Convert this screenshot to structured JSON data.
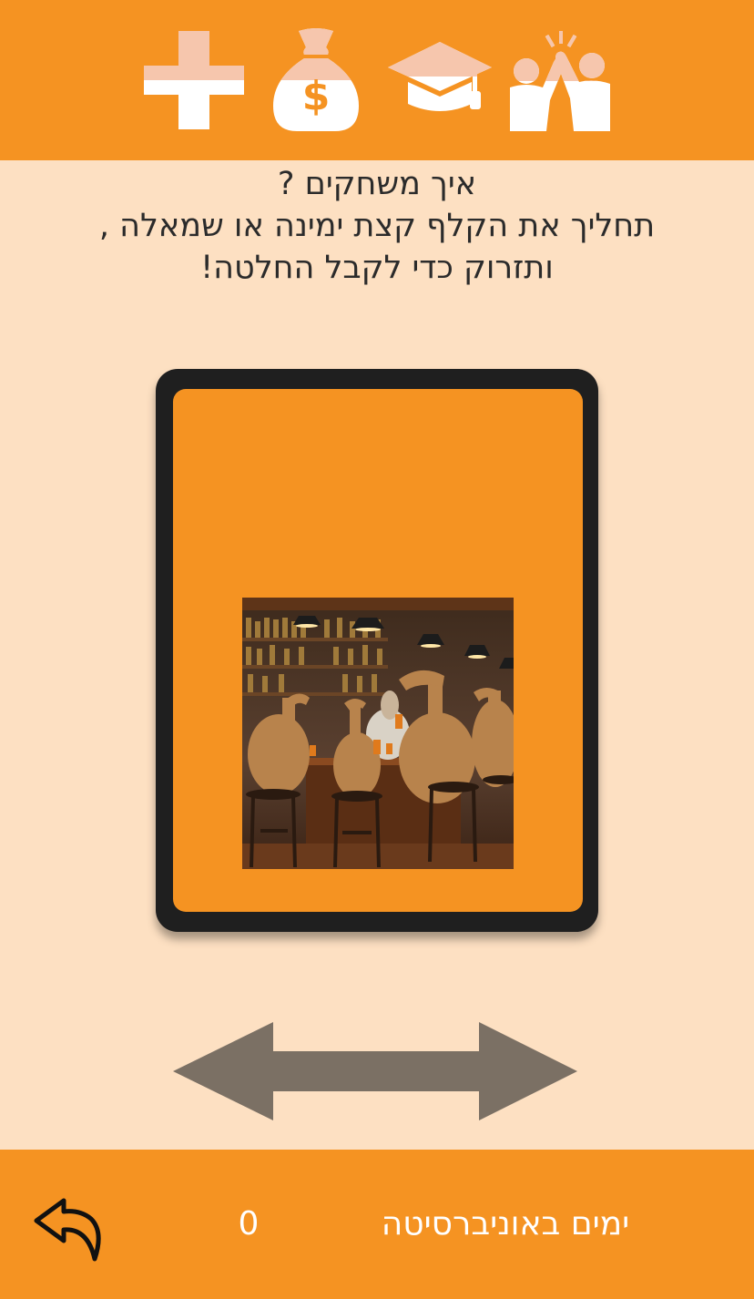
{
  "topbar": {
    "stats": [
      {
        "name": "health",
        "icon": "plus-icon",
        "fill_color": "#f6c6ad",
        "level": 0.5
      },
      {
        "name": "money",
        "icon": "money-bag-icon",
        "fill_color": "#f6c6ad",
        "level": 0.5
      },
      {
        "name": "education",
        "icon": "graduation-cap-icon",
        "fill_color": "#f6c6ad",
        "level": 0.5
      },
      {
        "name": "social",
        "icon": "high-five-icon",
        "fill_color": "#f6c6ad",
        "level": 0.5
      }
    ]
  },
  "instructions": {
    "line1": "איך משחקים ?",
    "line2": "תחליך את הקלף קצת ימינה או שמאלה ,",
    "line3": "ותזרוק כדי לקבל החלטה!"
  },
  "card": {
    "image_icon": "camels-at-bar-picture"
  },
  "swipe_hint": {
    "icon": "double-arrow-left-right-icon",
    "color": "#7b7064"
  },
  "bottombar": {
    "back_icon": "undo-arrow-icon",
    "days_count": "0",
    "days_label": "ימים באוניברסיטה"
  },
  "colors": {
    "accent": "#f59322",
    "background": "#fde0c2",
    "card_frame": "#1f1f1f",
    "icon_fill": "#f6c6ad"
  }
}
